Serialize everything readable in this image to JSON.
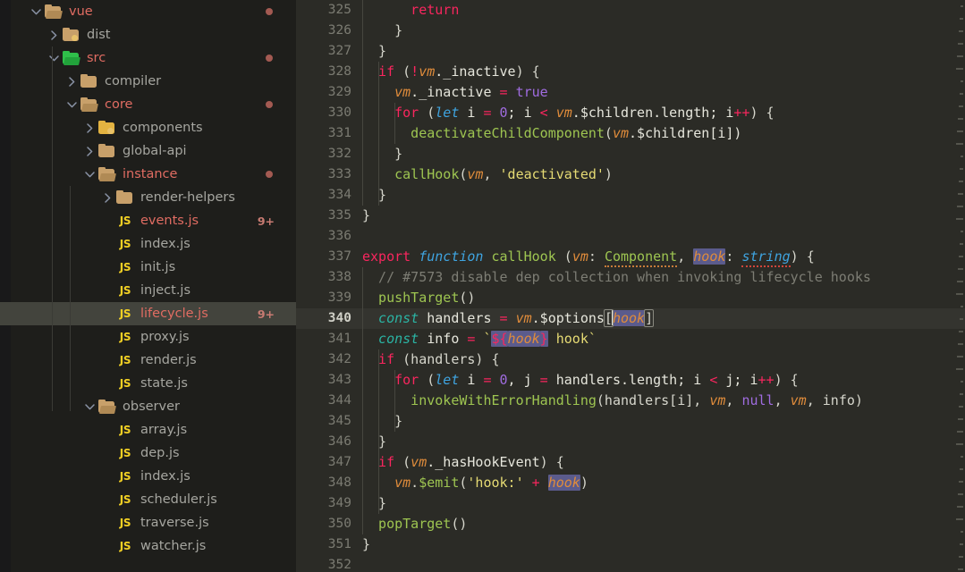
{
  "sidebar": {
    "tree": [
      {
        "depth": 0,
        "chevron": "down",
        "icon": "folder-open-icon",
        "label": "vue",
        "state": "modified",
        "dot": true,
        "badge": ""
      },
      {
        "depth": 1,
        "chevron": "right",
        "icon": "folder-dist-icon",
        "label": "dist",
        "state": "plain",
        "dot": false,
        "badge": ""
      },
      {
        "depth": 1,
        "chevron": "down",
        "icon": "folder-src-icon",
        "label": "src",
        "state": "modified",
        "dot": true,
        "badge": ""
      },
      {
        "depth": 2,
        "chevron": "right",
        "icon": "folder-icon",
        "label": "compiler",
        "state": "plain",
        "dot": false,
        "badge": ""
      },
      {
        "depth": 2,
        "chevron": "down",
        "icon": "folder-open-icon",
        "label": "core",
        "state": "modified",
        "dot": true,
        "badge": ""
      },
      {
        "depth": 3,
        "chevron": "right",
        "icon": "folder-components-icon",
        "label": "components",
        "state": "plain",
        "dot": false,
        "badge": ""
      },
      {
        "depth": 3,
        "chevron": "right",
        "icon": "folder-icon",
        "label": "global-api",
        "state": "plain",
        "dot": false,
        "badge": ""
      },
      {
        "depth": 3,
        "chevron": "down",
        "icon": "folder-open-icon",
        "label": "instance",
        "state": "modified",
        "dot": true,
        "badge": ""
      },
      {
        "depth": 4,
        "chevron": "right",
        "icon": "folder-icon",
        "label": "render-helpers",
        "state": "plain",
        "dot": false,
        "badge": ""
      },
      {
        "depth": 4,
        "chevron": "none",
        "icon": "js-file-icon",
        "label": "events.js",
        "state": "modified",
        "dot": false,
        "badge": "9+"
      },
      {
        "depth": 4,
        "chevron": "none",
        "icon": "js-file-icon",
        "label": "index.js",
        "state": "plain",
        "dot": false,
        "badge": ""
      },
      {
        "depth": 4,
        "chevron": "none",
        "icon": "js-file-icon",
        "label": "init.js",
        "state": "plain",
        "dot": false,
        "badge": ""
      },
      {
        "depth": 4,
        "chevron": "none",
        "icon": "js-file-icon",
        "label": "inject.js",
        "state": "plain",
        "dot": false,
        "badge": ""
      },
      {
        "depth": 4,
        "chevron": "none",
        "icon": "js-file-icon",
        "label": "lifecycle.js",
        "state": "modified",
        "dot": false,
        "badge": "9+",
        "selected": true
      },
      {
        "depth": 4,
        "chevron": "none",
        "icon": "js-file-icon",
        "label": "proxy.js",
        "state": "plain",
        "dot": false,
        "badge": ""
      },
      {
        "depth": 4,
        "chevron": "none",
        "icon": "js-file-icon",
        "label": "render.js",
        "state": "plain",
        "dot": false,
        "badge": ""
      },
      {
        "depth": 4,
        "chevron": "none",
        "icon": "js-file-icon",
        "label": "state.js",
        "state": "plain",
        "dot": false,
        "badge": ""
      },
      {
        "depth": 3,
        "chevron": "down",
        "icon": "folder-open-icon",
        "label": "observer",
        "state": "plain",
        "dot": false,
        "badge": ""
      },
      {
        "depth": 4,
        "chevron": "none",
        "icon": "js-file-icon",
        "label": "array.js",
        "state": "plain",
        "dot": false,
        "badge": ""
      },
      {
        "depth": 4,
        "chevron": "none",
        "icon": "js-file-icon",
        "label": "dep.js",
        "state": "plain",
        "dot": false,
        "badge": ""
      },
      {
        "depth": 4,
        "chevron": "none",
        "icon": "js-file-icon",
        "label": "index.js",
        "state": "plain",
        "dot": false,
        "badge": ""
      },
      {
        "depth": 4,
        "chevron": "none",
        "icon": "js-file-icon",
        "label": "scheduler.js",
        "state": "plain",
        "dot": false,
        "badge": ""
      },
      {
        "depth": 4,
        "chevron": "none",
        "icon": "js-file-icon",
        "label": "traverse.js",
        "state": "plain",
        "dot": false,
        "badge": ""
      },
      {
        "depth": 4,
        "chevron": "none",
        "icon": "js-file-icon",
        "label": "watcher.js",
        "state": "plain",
        "dot": false,
        "badge": ""
      }
    ]
  },
  "editor": {
    "active_line": 340,
    "lines": [
      {
        "n": 325,
        "indent": 3,
        "tokens": [
          {
            "t": "return",
            "c": "t-key"
          }
        ]
      },
      {
        "n": 326,
        "indent": 2,
        "tokens": [
          {
            "t": "}",
            "c": "t-punc"
          }
        ]
      },
      {
        "n": 327,
        "indent": 1,
        "tokens": [
          {
            "t": "}",
            "c": "t-punc"
          }
        ]
      },
      {
        "n": 328,
        "indent": 1,
        "tokens": [
          {
            "t": "if",
            "c": "t-key"
          },
          {
            "t": " (",
            "c": "t-punc"
          },
          {
            "t": "!",
            "c": "t-op"
          },
          {
            "t": "vm",
            "c": "t-var"
          },
          {
            "t": "._inactive",
            "c": "t-prop"
          },
          {
            "t": ") {",
            "c": "t-punc"
          }
        ]
      },
      {
        "n": 329,
        "indent": 2,
        "tokens": [
          {
            "t": "vm",
            "c": "t-var"
          },
          {
            "t": "._inactive ",
            "c": "t-prop"
          },
          {
            "t": "=",
            "c": "t-op"
          },
          {
            "t": " ",
            "c": "t-punc"
          },
          {
            "t": "true",
            "c": "t-bool"
          }
        ]
      },
      {
        "n": 330,
        "indent": 2,
        "tokens": [
          {
            "t": "for",
            "c": "t-key"
          },
          {
            "t": " (",
            "c": "t-punc"
          },
          {
            "t": "let",
            "c": "t-kw2"
          },
          {
            "t": " i ",
            "c": "t-prop"
          },
          {
            "t": "=",
            "c": "t-op"
          },
          {
            "t": " ",
            "c": "t-punc"
          },
          {
            "t": "0",
            "c": "t-num"
          },
          {
            "t": "; i ",
            "c": "t-prop"
          },
          {
            "t": "<",
            "c": "t-op"
          },
          {
            "t": " ",
            "c": "t-punc"
          },
          {
            "t": "vm",
            "c": "t-var"
          },
          {
            "t": ".$children.length; i",
            "c": "t-prop"
          },
          {
            "t": "++",
            "c": "t-op"
          },
          {
            "t": ") {",
            "c": "t-punc"
          }
        ]
      },
      {
        "n": 331,
        "indent": 3,
        "tokens": [
          {
            "t": "deactivateChildComponent",
            "c": "t-fn"
          },
          {
            "t": "(",
            "c": "t-punc"
          },
          {
            "t": "vm",
            "c": "t-var"
          },
          {
            "t": ".$children[i])",
            "c": "t-prop"
          }
        ]
      },
      {
        "n": 332,
        "indent": 2,
        "tokens": [
          {
            "t": "}",
            "c": "t-punc"
          }
        ]
      },
      {
        "n": 333,
        "indent": 2,
        "tokens": [
          {
            "t": "callHook",
            "c": "t-fn"
          },
          {
            "t": "(",
            "c": "t-punc"
          },
          {
            "t": "vm",
            "c": "t-var"
          },
          {
            "t": ", ",
            "c": "t-punc"
          },
          {
            "t": "'deactivated'",
            "c": "t-str"
          },
          {
            "t": ")",
            "c": "t-punc"
          }
        ]
      },
      {
        "n": 334,
        "indent": 1,
        "tokens": [
          {
            "t": "}",
            "c": "t-punc"
          }
        ]
      },
      {
        "n": 335,
        "indent": 0,
        "tokens": [
          {
            "t": "}",
            "c": "t-punc"
          }
        ]
      },
      {
        "n": 336,
        "indent": 0,
        "tokens": []
      },
      {
        "n": 337,
        "indent": 0,
        "tokens": [
          {
            "t": "export",
            "c": "t-key"
          },
          {
            "t": " ",
            "c": "t-punc"
          },
          {
            "t": "function",
            "c": "t-kw2"
          },
          {
            "t": " ",
            "c": "t-punc"
          },
          {
            "t": "callHook",
            "c": "t-fn"
          },
          {
            "t": " (",
            "c": "t-punc"
          },
          {
            "t": "vm",
            "c": "t-var"
          },
          {
            "t": ":",
            "c": "t-punc"
          },
          {
            "t": " ",
            "c": "t-punc"
          },
          {
            "t": "Component",
            "c": "t-type",
            "underline": "orange"
          },
          {
            "t": ", ",
            "c": "t-punc"
          },
          {
            "t": "hook",
            "c": "t-var",
            "sel": true
          },
          {
            "t": ":",
            "c": "t-punc"
          },
          {
            "t": " ",
            "c": "t-punc"
          },
          {
            "t": "string",
            "c": "t-type2",
            "underline": "red"
          },
          {
            "t": ") {",
            "c": "t-punc"
          }
        ]
      },
      {
        "n": 338,
        "indent": 1,
        "tokens": [
          {
            "t": "// #7573 disable dep collection when invoking lifecycle hooks",
            "c": "t-cmt"
          }
        ]
      },
      {
        "n": 339,
        "indent": 1,
        "tokens": [
          {
            "t": "pushTarget",
            "c": "t-fn"
          },
          {
            "t": "()",
            "c": "t-punc"
          }
        ]
      },
      {
        "n": 340,
        "indent": 1,
        "tokens": [
          {
            "t": "const",
            "c": "t-const"
          },
          {
            "t": " handlers ",
            "c": "t-prop"
          },
          {
            "t": "=",
            "c": "t-op"
          },
          {
            "t": " ",
            "c": "t-punc"
          },
          {
            "t": "vm",
            "c": "t-var"
          },
          {
            "t": ".$options",
            "c": "t-prop"
          },
          {
            "t": "[",
            "c": "t-punc",
            "box": true
          },
          {
            "t": "CURSOR",
            "c": "cursor"
          },
          {
            "t": "hook",
            "c": "t-var",
            "sel": true
          },
          {
            "t": "]",
            "c": "t-punc",
            "box": true
          }
        ]
      },
      {
        "n": 341,
        "indent": 1,
        "tokens": [
          {
            "t": "const",
            "c": "t-const"
          },
          {
            "t": " info ",
            "c": "t-prop"
          },
          {
            "t": "=",
            "c": "t-op"
          },
          {
            "t": " ",
            "c": "t-punc"
          },
          {
            "t": "`",
            "c": "t-str"
          },
          {
            "t": "${",
            "c": "t-op",
            "sel": true
          },
          {
            "t": "hook",
            "c": "t-var",
            "sel": true
          },
          {
            "t": "}",
            "c": "t-op",
            "sel": true
          },
          {
            "t": " hook`",
            "c": "t-str"
          }
        ]
      },
      {
        "n": 342,
        "indent": 1,
        "tokens": [
          {
            "t": "if",
            "c": "t-key"
          },
          {
            "t": " (handlers) {",
            "c": "t-punc"
          }
        ]
      },
      {
        "n": 343,
        "indent": 2,
        "tokens": [
          {
            "t": "for",
            "c": "t-key"
          },
          {
            "t": " (",
            "c": "t-punc"
          },
          {
            "t": "let",
            "c": "t-kw2"
          },
          {
            "t": " i ",
            "c": "t-prop"
          },
          {
            "t": "=",
            "c": "t-op"
          },
          {
            "t": " ",
            "c": "t-punc"
          },
          {
            "t": "0",
            "c": "t-num"
          },
          {
            "t": ", j ",
            "c": "t-prop"
          },
          {
            "t": "=",
            "c": "t-op"
          },
          {
            "t": " handlers.length; i ",
            "c": "t-prop"
          },
          {
            "t": "<",
            "c": "t-op"
          },
          {
            "t": " j; i",
            "c": "t-prop"
          },
          {
            "t": "++",
            "c": "t-op"
          },
          {
            "t": ") {",
            "c": "t-punc"
          }
        ]
      },
      {
        "n": 344,
        "indent": 3,
        "tokens": [
          {
            "t": "invokeWithErrorHandling",
            "c": "t-fn"
          },
          {
            "t": "(handlers[i], ",
            "c": "t-punc"
          },
          {
            "t": "vm",
            "c": "t-var"
          },
          {
            "t": ", ",
            "c": "t-punc"
          },
          {
            "t": "null",
            "c": "t-num"
          },
          {
            "t": ", ",
            "c": "t-punc"
          },
          {
            "t": "vm",
            "c": "t-var"
          },
          {
            "t": ", info)",
            "c": "t-punc"
          }
        ]
      },
      {
        "n": 345,
        "indent": 2,
        "tokens": [
          {
            "t": "}",
            "c": "t-punc"
          }
        ]
      },
      {
        "n": 346,
        "indent": 1,
        "tokens": [
          {
            "t": "}",
            "c": "t-punc"
          }
        ]
      },
      {
        "n": 347,
        "indent": 1,
        "tokens": [
          {
            "t": "if",
            "c": "t-key"
          },
          {
            "t": " (",
            "c": "t-punc"
          },
          {
            "t": "vm",
            "c": "t-var"
          },
          {
            "t": "._hasHookEvent",
            "c": "t-prop"
          },
          {
            "t": ") {",
            "c": "t-punc"
          }
        ]
      },
      {
        "n": 348,
        "indent": 2,
        "tokens": [
          {
            "t": "vm",
            "c": "t-var"
          },
          {
            "t": ".",
            "c": "t-punc"
          },
          {
            "t": "$emit",
            "c": "t-fn"
          },
          {
            "t": "(",
            "c": "t-punc"
          },
          {
            "t": "'hook:'",
            "c": "t-str"
          },
          {
            "t": " ",
            "c": "t-punc"
          },
          {
            "t": "+",
            "c": "t-op"
          },
          {
            "t": " ",
            "c": "t-punc"
          },
          {
            "t": "hook",
            "c": "t-var",
            "sel": true
          },
          {
            "t": ")",
            "c": "t-punc"
          }
        ]
      },
      {
        "n": 349,
        "indent": 1,
        "tokens": [
          {
            "t": "}",
            "c": "t-punc"
          }
        ]
      },
      {
        "n": 350,
        "indent": 1,
        "tokens": [
          {
            "t": "popTarget",
            "c": "t-fn"
          },
          {
            "t": "()",
            "c": "t-punc"
          }
        ]
      },
      {
        "n": 351,
        "indent": 0,
        "tokens": [
          {
            "t": "}",
            "c": "t-punc"
          }
        ]
      },
      {
        "n": 352,
        "indent": 0,
        "tokens": []
      }
    ]
  },
  "colors": {
    "sidebar_bg": "#1e1e1b",
    "editor_bg": "#2b2b26",
    "selected_row_bg": "#43443d",
    "active_line_bg": "#34342f",
    "modified_file": "#e06c62",
    "badge": "#c87b72",
    "js_icon": "#f2d024",
    "selection_highlight": "#5b5b8c"
  }
}
